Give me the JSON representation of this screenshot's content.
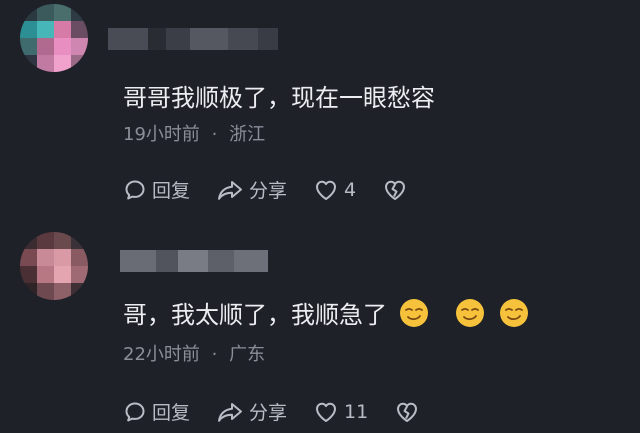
{
  "comments": [
    {
      "text": "哥哥我顺极了，现在一眼愁容",
      "time": "19小时前",
      "separator": "·",
      "location": "浙江",
      "reply_label": "回复",
      "share_label": "分享",
      "like_count": "4",
      "emoji_count": 0
    },
    {
      "text": "哥，我太顺了，我顺急了",
      "time": "22小时前",
      "separator": "·",
      "location": "广东",
      "reply_label": "回复",
      "share_label": "分享",
      "like_count": "11",
      "emoji_count": 3
    }
  ],
  "icons": {
    "reply": "comment-bubble-icon",
    "share": "share-arrow-icon",
    "like": "heart-icon",
    "dislike": "broken-heart-icon",
    "emoji": "smug-face-emoji"
  },
  "colors": {
    "background": "#1f2129",
    "text": "#ecedf0",
    "meta": "#8b8e98",
    "action": "#b9bcc4",
    "emoji": "#f6c23c"
  }
}
